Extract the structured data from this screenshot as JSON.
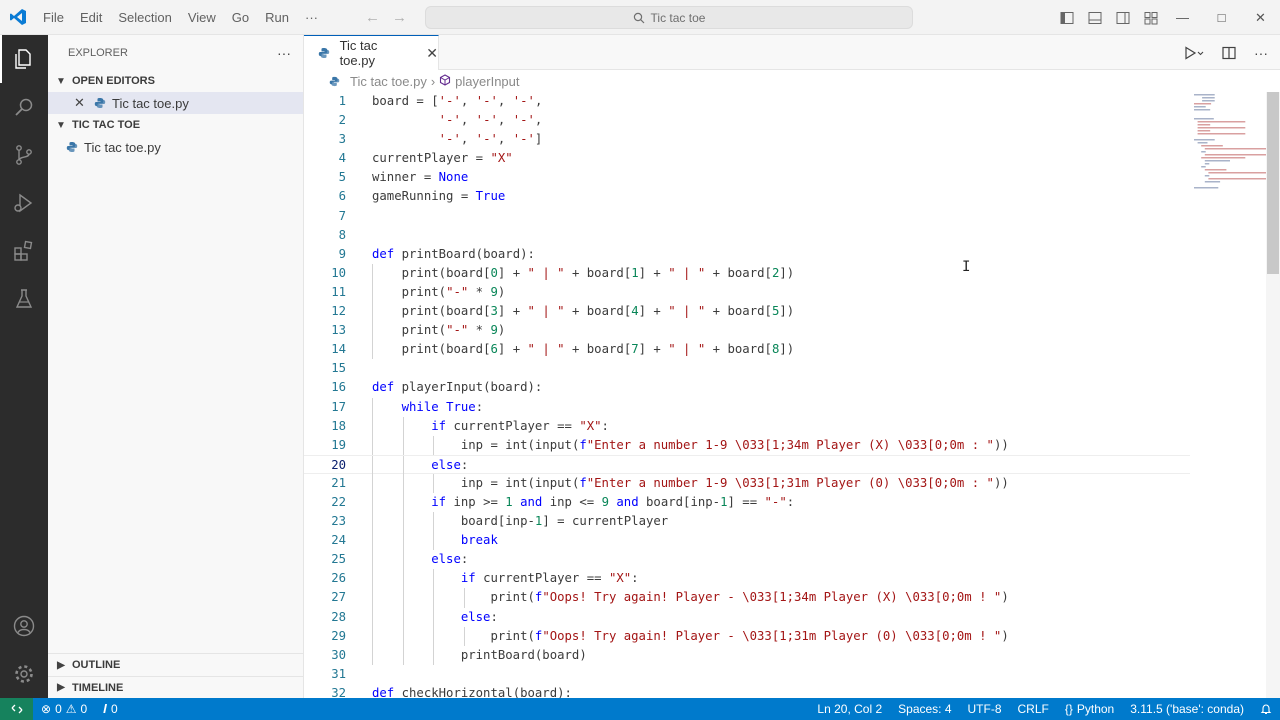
{
  "menu": [
    "File",
    "Edit",
    "Selection",
    "View",
    "Go",
    "Run",
    "···"
  ],
  "search_text": "Tic tac toe",
  "sidebar": {
    "header": "EXPLORER",
    "more": "···",
    "open_editors_label": "OPEN EDITORS",
    "open_editor_file": "Tic tac toe.py",
    "folder_label": "TIC TAC TOE",
    "folder_file": "Tic tac toe.py",
    "outline_label": "OUTLINE",
    "timeline_label": "TIMELINE"
  },
  "tab": {
    "label": "Tic tac toe.py"
  },
  "breadcrumb": {
    "file": "Tic tac toe.py",
    "symbol": "playerInput"
  },
  "code": {
    "current_line": 20,
    "lines": [
      [
        [
          "board",
          "v"
        ],
        [
          " = [",
          "p"
        ],
        [
          "'-'",
          "s"
        ],
        [
          ", ",
          "p"
        ],
        [
          "'-'",
          "s"
        ],
        [
          ", ",
          "p"
        ],
        [
          "'-'",
          "s"
        ],
        [
          ",",
          "p"
        ]
      ],
      [
        [
          "         ",
          "p"
        ],
        [
          "'-'",
          "s"
        ],
        [
          ", ",
          "p"
        ],
        [
          "'-'",
          "s"
        ],
        [
          ", ",
          "p"
        ],
        [
          "'-'",
          "s"
        ],
        [
          ",",
          "p"
        ]
      ],
      [
        [
          "         ",
          "p"
        ],
        [
          "'-'",
          "s"
        ],
        [
          ", ",
          "p"
        ],
        [
          "'-'",
          "s"
        ],
        [
          ", ",
          "p"
        ],
        [
          "'-'",
          "s"
        ],
        [
          "]",
          "p"
        ]
      ],
      [
        [
          "currentPlayer",
          "v"
        ],
        [
          " = ",
          "p"
        ],
        [
          "\"X\"",
          "s"
        ]
      ],
      [
        [
          "winner",
          "v"
        ],
        [
          " = ",
          "p"
        ],
        [
          "None",
          "k"
        ]
      ],
      [
        [
          "gameRunning",
          "v"
        ],
        [
          " = ",
          "p"
        ],
        [
          "True",
          "k"
        ]
      ],
      [],
      [],
      [
        [
          "def",
          "k"
        ],
        [
          " ",
          "p"
        ],
        [
          "printBoard",
          "f"
        ],
        [
          "(",
          "p"
        ],
        [
          "board",
          "v"
        ],
        [
          "):",
          "p"
        ]
      ],
      [
        [
          "    ",
          "p"
        ],
        [
          "print",
          "f"
        ],
        [
          "(",
          "p"
        ],
        [
          "board",
          "v"
        ],
        [
          "[",
          "p"
        ],
        [
          "0",
          "n"
        ],
        [
          "] + ",
          "p"
        ],
        [
          "\" | \"",
          "s"
        ],
        [
          " + ",
          "p"
        ],
        [
          "board",
          "v"
        ],
        [
          "[",
          "p"
        ],
        [
          "1",
          "n"
        ],
        [
          "] + ",
          "p"
        ],
        [
          "\" | \"",
          "s"
        ],
        [
          " + ",
          "p"
        ],
        [
          "board",
          "v"
        ],
        [
          "[",
          "p"
        ],
        [
          "2",
          "n"
        ],
        [
          "])",
          "p"
        ]
      ],
      [
        [
          "    ",
          "p"
        ],
        [
          "print",
          "f"
        ],
        [
          "(",
          "p"
        ],
        [
          "\"-\"",
          "s"
        ],
        [
          " * ",
          "p"
        ],
        [
          "9",
          "n"
        ],
        [
          ")",
          "p"
        ]
      ],
      [
        [
          "    ",
          "p"
        ],
        [
          "print",
          "f"
        ],
        [
          "(",
          "p"
        ],
        [
          "board",
          "v"
        ],
        [
          "[",
          "p"
        ],
        [
          "3",
          "n"
        ],
        [
          "] + ",
          "p"
        ],
        [
          "\" | \"",
          "s"
        ],
        [
          " + ",
          "p"
        ],
        [
          "board",
          "v"
        ],
        [
          "[",
          "p"
        ],
        [
          "4",
          "n"
        ],
        [
          "] + ",
          "p"
        ],
        [
          "\" | \"",
          "s"
        ],
        [
          " + ",
          "p"
        ],
        [
          "board",
          "v"
        ],
        [
          "[",
          "p"
        ],
        [
          "5",
          "n"
        ],
        [
          "])",
          "p"
        ]
      ],
      [
        [
          "    ",
          "p"
        ],
        [
          "print",
          "f"
        ],
        [
          "(",
          "p"
        ],
        [
          "\"-\"",
          "s"
        ],
        [
          " * ",
          "p"
        ],
        [
          "9",
          "n"
        ],
        [
          ")",
          "p"
        ]
      ],
      [
        [
          "    ",
          "p"
        ],
        [
          "print",
          "f"
        ],
        [
          "(",
          "p"
        ],
        [
          "board",
          "v"
        ],
        [
          "[",
          "p"
        ],
        [
          "6",
          "n"
        ],
        [
          "] + ",
          "p"
        ],
        [
          "\" | \"",
          "s"
        ],
        [
          " + ",
          "p"
        ],
        [
          "board",
          "v"
        ],
        [
          "[",
          "p"
        ],
        [
          "7",
          "n"
        ],
        [
          "] + ",
          "p"
        ],
        [
          "\" | \"",
          "s"
        ],
        [
          " + ",
          "p"
        ],
        [
          "board",
          "v"
        ],
        [
          "[",
          "p"
        ],
        [
          "8",
          "n"
        ],
        [
          "])",
          "p"
        ]
      ],
      [],
      [
        [
          "def",
          "k"
        ],
        [
          " ",
          "p"
        ],
        [
          "playerInput",
          "f"
        ],
        [
          "(",
          "p"
        ],
        [
          "board",
          "v"
        ],
        [
          "):",
          "p"
        ]
      ],
      [
        [
          "    ",
          "p"
        ],
        [
          "while",
          "k"
        ],
        [
          " ",
          "p"
        ],
        [
          "True",
          "k"
        ],
        [
          ":",
          "p"
        ]
      ],
      [
        [
          "        ",
          "p"
        ],
        [
          "if",
          "k"
        ],
        [
          " ",
          "p"
        ],
        [
          "currentPlayer",
          "v"
        ],
        [
          " == ",
          "p"
        ],
        [
          "\"X\"",
          "s"
        ],
        [
          ":",
          "p"
        ]
      ],
      [
        [
          "            ",
          "p"
        ],
        [
          "inp",
          "v"
        ],
        [
          " = ",
          "p"
        ],
        [
          "int",
          "t"
        ],
        [
          "(",
          "p"
        ],
        [
          "input",
          "f"
        ],
        [
          "(",
          "p"
        ],
        [
          "f",
          "k"
        ],
        [
          "\"Enter a number 1-9 \\033[1;34m Player (X) \\033[0;0m : \"",
          "s"
        ],
        [
          "))",
          "p"
        ]
      ],
      [
        [
          "        ",
          "p"
        ],
        [
          "else",
          "k"
        ],
        [
          ":",
          "p"
        ]
      ],
      [
        [
          "            ",
          "p"
        ],
        [
          "inp",
          "v"
        ],
        [
          " = ",
          "p"
        ],
        [
          "int",
          "t"
        ],
        [
          "(",
          "p"
        ],
        [
          "input",
          "f"
        ],
        [
          "(",
          "p"
        ],
        [
          "f",
          "k"
        ],
        [
          "\"Enter a number 1-9 \\033[1;31m Player (0) \\033[0;0m : \"",
          "s"
        ],
        [
          "))",
          "p"
        ]
      ],
      [
        [
          "        ",
          "p"
        ],
        [
          "if",
          "k"
        ],
        [
          " ",
          "p"
        ],
        [
          "inp",
          "v"
        ],
        [
          " >= ",
          "p"
        ],
        [
          "1",
          "n"
        ],
        [
          " ",
          "p"
        ],
        [
          "and",
          "k"
        ],
        [
          " ",
          "p"
        ],
        [
          "inp",
          "v"
        ],
        [
          " <= ",
          "p"
        ],
        [
          "9",
          "n"
        ],
        [
          " ",
          "p"
        ],
        [
          "and",
          "k"
        ],
        [
          " ",
          "p"
        ],
        [
          "board",
          "v"
        ],
        [
          "[",
          "p"
        ],
        [
          "inp",
          "v"
        ],
        [
          "-",
          "p"
        ],
        [
          "1",
          "n"
        ],
        [
          "] == ",
          "p"
        ],
        [
          "\"-\"",
          "s"
        ],
        [
          ":",
          "p"
        ]
      ],
      [
        [
          "            ",
          "p"
        ],
        [
          "board",
          "v"
        ],
        [
          "[",
          "p"
        ],
        [
          "inp",
          "v"
        ],
        [
          "-",
          "p"
        ],
        [
          "1",
          "n"
        ],
        [
          "] = ",
          "p"
        ],
        [
          "currentPlayer",
          "v"
        ]
      ],
      [
        [
          "            ",
          "p"
        ],
        [
          "break",
          "k"
        ]
      ],
      [
        [
          "        ",
          "p"
        ],
        [
          "else",
          "k"
        ],
        [
          ":",
          "p"
        ]
      ],
      [
        [
          "            ",
          "p"
        ],
        [
          "if",
          "k"
        ],
        [
          " ",
          "p"
        ],
        [
          "currentPlayer",
          "v"
        ],
        [
          " == ",
          "p"
        ],
        [
          "\"X\"",
          "s"
        ],
        [
          ":",
          "p"
        ]
      ],
      [
        [
          "                ",
          "p"
        ],
        [
          "print",
          "f"
        ],
        [
          "(",
          "p"
        ],
        [
          "f",
          "k"
        ],
        [
          "\"Oops! Try again! Player - \\033[1;34m Player (X) \\033[0;0m ! \"",
          "s"
        ],
        [
          ")",
          "p"
        ]
      ],
      [
        [
          "            ",
          "p"
        ],
        [
          "else",
          "k"
        ],
        [
          ":",
          "p"
        ]
      ],
      [
        [
          "                ",
          "p"
        ],
        [
          "print",
          "f"
        ],
        [
          "(",
          "p"
        ],
        [
          "f",
          "k"
        ],
        [
          "\"Oops! Try again! Player - \\033[1;31m Player (0) \\033[0;0m ! \"",
          "s"
        ],
        [
          ")",
          "p"
        ]
      ],
      [
        [
          "            ",
          "p"
        ],
        [
          "printBoard",
          "f"
        ],
        [
          "(",
          "p"
        ],
        [
          "board",
          "v"
        ],
        [
          ")",
          "p"
        ]
      ],
      [],
      [
        [
          "def",
          "k"
        ],
        [
          " ",
          "p"
        ],
        [
          "checkHorizontal",
          "f"
        ],
        [
          "(",
          "p"
        ],
        [
          "board",
          "v"
        ],
        [
          "):",
          "p"
        ]
      ]
    ]
  },
  "status": {
    "errors": "0",
    "warnings": "0",
    "ports": "0",
    "position": "Ln 20, Col 2",
    "spaces": "Spaces: 4",
    "encoding": "UTF-8",
    "eol": "CRLF",
    "language": "Python",
    "interpreter": "3.11.5 ('base': conda)"
  },
  "colors": {
    "keyword": "#0000ff",
    "string": "#a31515",
    "number": "#098658",
    "plain": "#3b3b3b",
    "status_bg": "#007acc",
    "activity_bg": "#2c2c2c"
  }
}
